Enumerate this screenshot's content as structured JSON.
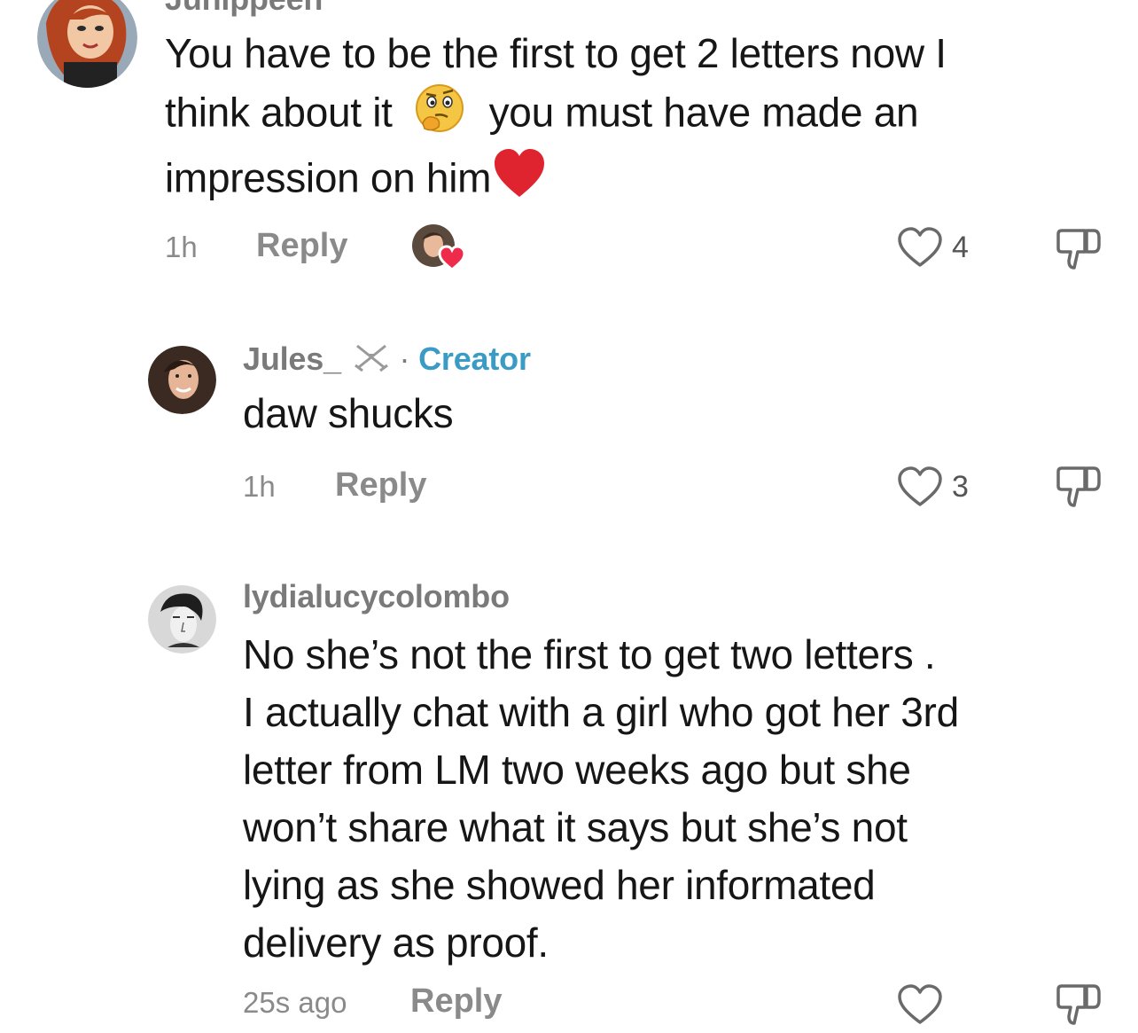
{
  "comments": [
    {
      "username": "Junippeen",
      "text_line1": "You have to be the first to get 2 letters now I",
      "text_line2a": "think about it",
      "text_line2b": "you must have made an",
      "text_line3": "impression on him",
      "time": "1h",
      "reply_label": "Reply",
      "likes": "4",
      "emoji_thinking": "thinking-face-emoji",
      "emoji_heart": "red-heart-emoji",
      "creator_liked": true
    },
    {
      "username": "Jules_",
      "separator": "·",
      "creator_label": "Creator",
      "text": "daw shucks",
      "time": "1h",
      "reply_label": "Reply",
      "likes": "3"
    },
    {
      "username": "lydialucycolombo",
      "text_lines": [
        "No she’s not the first to get two letters .",
        "I actually chat with a girl who got her 3rd",
        "letter from LM two weeks ago but she",
        "won’t share what it says but she’s not",
        "lying as she showed her informated",
        "delivery as proof."
      ],
      "time": "25s ago",
      "reply_label": "Reply"
    }
  ],
  "colors": {
    "creator": "#3a9bc4",
    "muted": "#8a8a8a",
    "heart": "#e0242f"
  }
}
